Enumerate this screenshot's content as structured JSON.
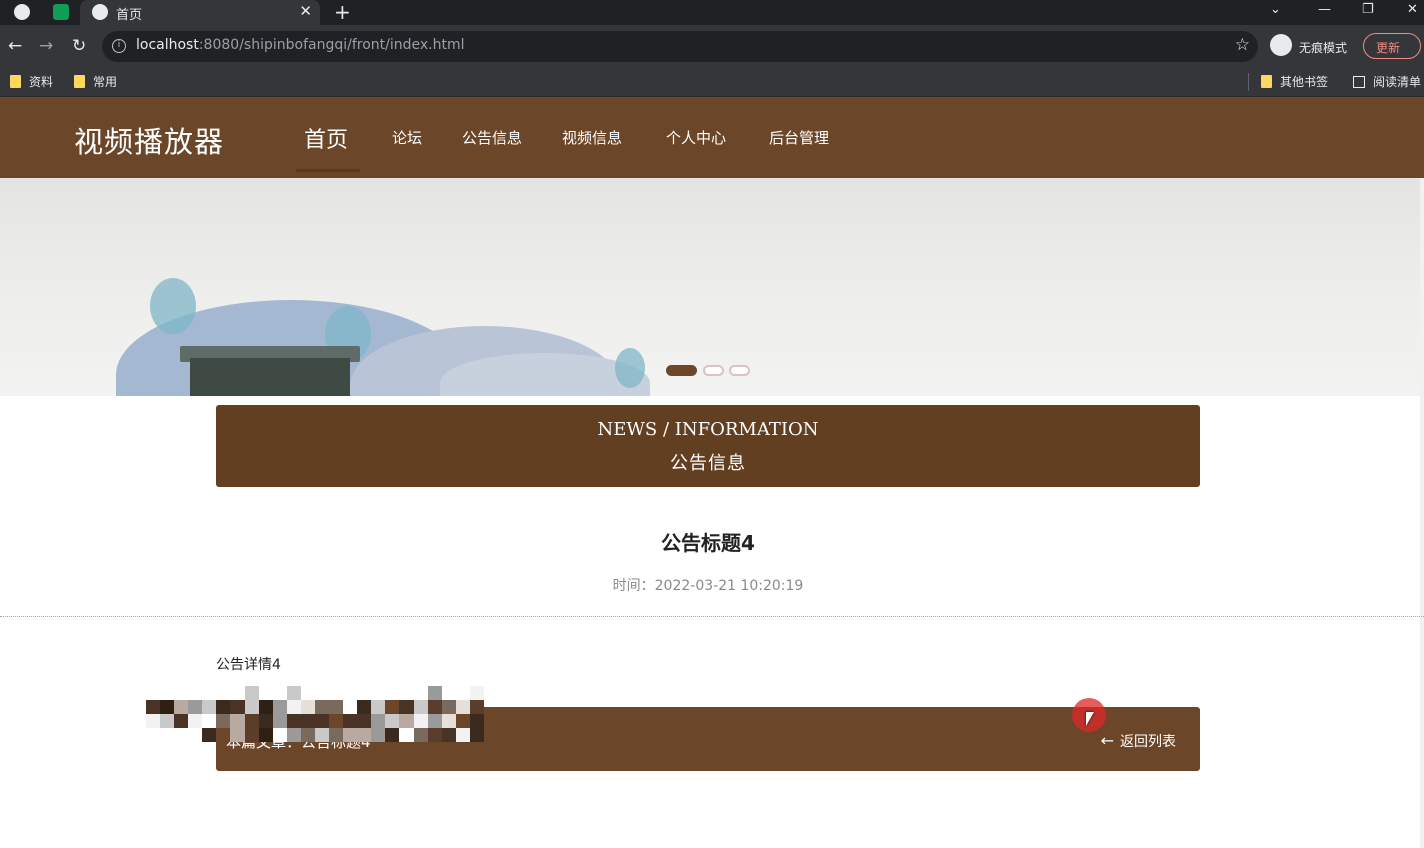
{
  "browser": {
    "tab_title": "首页",
    "tab_close": "✕",
    "new_tab": "+",
    "url_host": "localhost",
    "url_rest": ":8080/shipinbofangqi/front/index.html",
    "incognito_label": "无痕模式",
    "update_label": "更新",
    "bookmarks": [
      "资料",
      "常用"
    ],
    "bookmarks_right": [
      "其他书签",
      "阅读清单"
    ]
  },
  "site": {
    "logo": "视频播放器",
    "nav": [
      "首页",
      "论坛",
      "公告信息",
      "视频信息",
      "个人中心",
      "后台管理"
    ]
  },
  "banner": {
    "active_slide": 1,
    "slide_count": 3
  },
  "section": {
    "title_en": "NEWS / INFORMATION",
    "title_cn": "公告信息"
  },
  "article": {
    "title": "公告标题4",
    "time_label": "时间：",
    "time_value": "2022-03-21 10:20:19",
    "body": "公告详情4"
  },
  "footer_nav": {
    "current_article": "本篇文章：公告标题4",
    "back_label": "返回列表"
  },
  "colors": {
    "brand_brown": "#6b4628",
    "section_brown": "#633f22",
    "cursor_red": "#dc2828"
  }
}
